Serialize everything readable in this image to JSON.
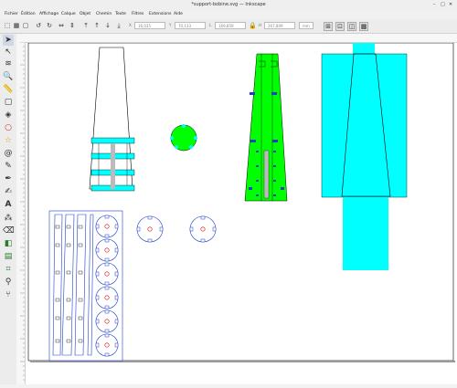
{
  "window": {
    "title": "*support-bobine.svg — Inkscape"
  },
  "menu": [
    "Fichier",
    "Édition",
    "Affichage",
    "Calque",
    "Objet",
    "Chemin",
    "Texte",
    "Filtres",
    "Extensions",
    "Aide"
  ],
  "toolbar": {
    "x_label": "X",
    "x_value": "16,035",
    "y_label": "Y",
    "y_value": "70,133",
    "w_label": "L",
    "w_value": "169,859",
    "h_label": "H",
    "h_value": "267,809",
    "unit": "mm"
  },
  "tools": [
    "selector-tool-icon",
    "node-tool-icon",
    "tweak-tool-icon",
    "zoom-tool-icon",
    "measure-tool-icon",
    "rect-tool-icon",
    "3dbox-tool-icon",
    "ellipse-tool-icon",
    "star-tool-icon",
    "spiral-tool-icon",
    "pencil-tool-icon",
    "pen-tool-icon",
    "calligraphy-tool-icon",
    "text-tool-icon",
    "spray-tool-icon",
    "eraser-tool-icon",
    "paint-bucket-tool-icon",
    "gradient-tool-icon",
    "mesh-tool-icon",
    "dropper-tool-icon",
    "connector-tool-icon"
  ],
  "colors": {
    "cyan": "#00ffff",
    "green": "#00ff00",
    "blue": "#1d3fc7",
    "red": "#d40000",
    "line": "#000000"
  }
}
